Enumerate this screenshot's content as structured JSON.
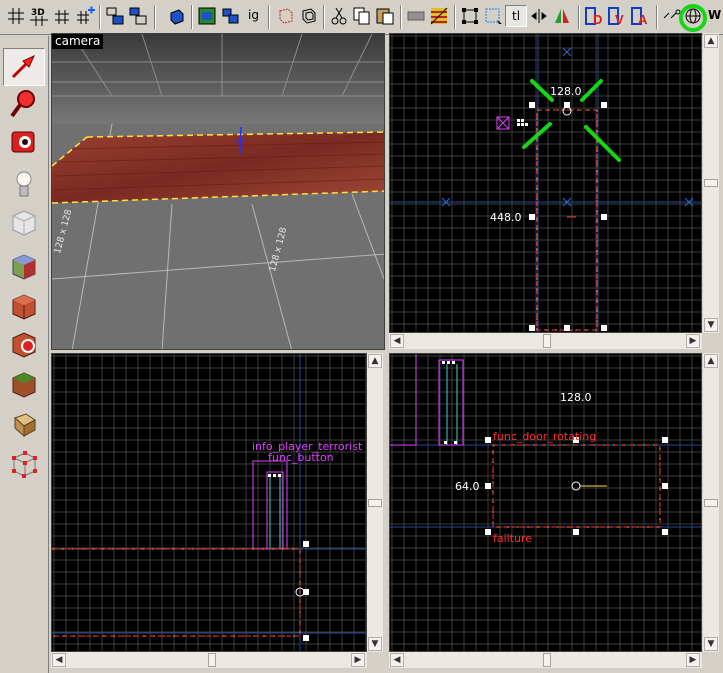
{
  "toolbar": {
    "label_3d": "3D",
    "label_ig": "ig",
    "label_tl": "tl",
    "label_ww": "W",
    "highlight_color": "#17d617"
  },
  "left_tools": [
    {
      "name": "selection-tool",
      "icon": "arrow-icon",
      "selected": true
    },
    {
      "name": "magnify-tool",
      "icon": "magnifier-icon"
    },
    {
      "name": "camera-tool",
      "icon": "camera-icon"
    },
    {
      "name": "entity-tool",
      "icon": "lightbulb-icon"
    },
    {
      "name": "block-tool",
      "icon": "cube-icon"
    },
    {
      "name": "apply-texture-tool",
      "icon": "texture-cube-icon"
    },
    {
      "name": "apply-decal-tool",
      "icon": "decal-cube-icon"
    },
    {
      "name": "overlay-tool",
      "icon": "overlay-cube-icon"
    },
    {
      "name": "clipping-tool",
      "icon": "clip-cube-icon"
    },
    {
      "name": "vertex-tool",
      "icon": "vertex-icon"
    }
  ],
  "viewports": {
    "camera": {
      "label": "camera",
      "floor_markings": [
        "128 x 128",
        "128 x 128"
      ]
    },
    "top_right": {
      "width_label": "128.0",
      "height_label": "448.0"
    },
    "bottom_left": {
      "entity_label_1": "info_player_terrorist",
      "entity_label_2": "func_button"
    },
    "bottom_right": {
      "width_label": "128.0",
      "height_label": "64.0",
      "entity_label": "func_door_rotating",
      "entity_name": "failture"
    }
  },
  "colors": {
    "grid_line": "#3c3c3c",
    "grid_major": "#1e4a9c",
    "selection": "#ff3030",
    "entity": "#e040ff",
    "highlight": "#17d617"
  }
}
